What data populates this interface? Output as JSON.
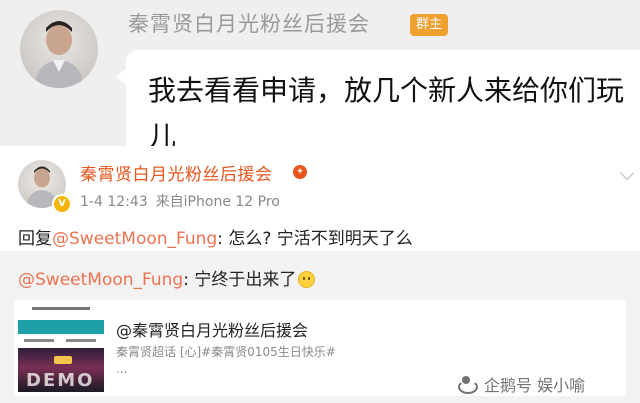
{
  "chat": {
    "sender_name": "秦霄贤白月光粉丝后援会",
    "role_badge": "群主",
    "message": "我去看看申请，放几个新人来给你们玩儿"
  },
  "post": {
    "author_name": "秦霄贤白月光粉丝后援会",
    "date": "1-4 12:43",
    "source": "来自iPhone 12 Pro",
    "reply_prefix": "回复",
    "reply_mention": "@SweetMoon_Fung",
    "reply_text": ": 怎么? 宁活不到明天了么"
  },
  "forwarded": {
    "mention": "@SweetMoon_Fung",
    "text": ": 宁终于出来了",
    "emoji": "smile-emoji"
  },
  "card": {
    "title": "@秦霄贤白月光粉丝后援会",
    "description": "秦霄贤超话 [心]#秦霄贤0105生日快乐#",
    "more": "...",
    "thumbnail_text": "DEMO"
  },
  "watermark": {
    "text": "企鹅号 娱小喻"
  },
  "colors": {
    "mention": "#eb7350",
    "author": "#e8561e",
    "badge": "#f0a030"
  }
}
